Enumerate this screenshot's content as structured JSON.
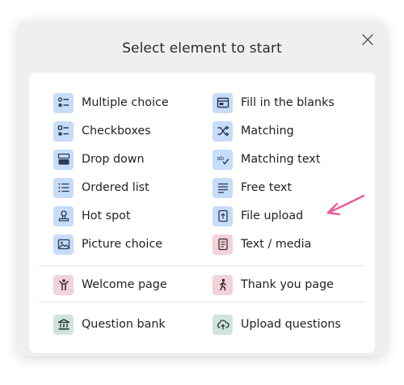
{
  "dialog": {
    "title": "Select element to start",
    "close_icon": "close-icon"
  },
  "elements": [
    {
      "label": "Multiple choice",
      "icon": "multiple-choice-icon",
      "color": "#c7dcf8"
    },
    {
      "label": "Fill in the blanks",
      "icon": "fill-blanks-icon",
      "color": "#c7dcf8"
    },
    {
      "label": "Checkboxes",
      "icon": "checkboxes-icon",
      "color": "#c7dcf8"
    },
    {
      "label": "Matching",
      "icon": "shuffle-icon",
      "color": "#c7dcf8"
    },
    {
      "label": "Drop down",
      "icon": "dropdown-icon",
      "color": "#c7dcf8"
    },
    {
      "label": "Matching text",
      "icon": "spellcheck-icon",
      "color": "#c7dcf8"
    },
    {
      "label": "Ordered list",
      "icon": "ordered-list-icon",
      "color": "#c7dcf8"
    },
    {
      "label": "Free text",
      "icon": "text-lines-icon",
      "color": "#c7dcf8"
    },
    {
      "label": "Hot spot",
      "icon": "hotspot-pin-icon",
      "color": "#c7dcf8"
    },
    {
      "label": "File upload",
      "icon": "file-upload-icon",
      "color": "#c7dcf8"
    },
    {
      "label": "Picture choice",
      "icon": "picture-icon",
      "color": "#c7dcf8"
    },
    {
      "label": "Text / media",
      "icon": "text-media-icon",
      "color": "#f2d3da"
    }
  ],
  "pages": [
    {
      "label": "Welcome page",
      "icon": "welcome-person-icon",
      "color": "#f2d3da"
    },
    {
      "label": "Thank you page",
      "icon": "walking-person-icon",
      "color": "#f2d3da"
    }
  ],
  "bank": [
    {
      "label": "Question bank",
      "icon": "bank-building-icon",
      "color": "#cfe5dc"
    },
    {
      "label": "Upload questions",
      "icon": "cloud-upload-icon",
      "color": "#cfe5dc"
    }
  ],
  "annotation": {
    "icon": "pink-arrow-icon",
    "color": "#ec5b9b"
  }
}
